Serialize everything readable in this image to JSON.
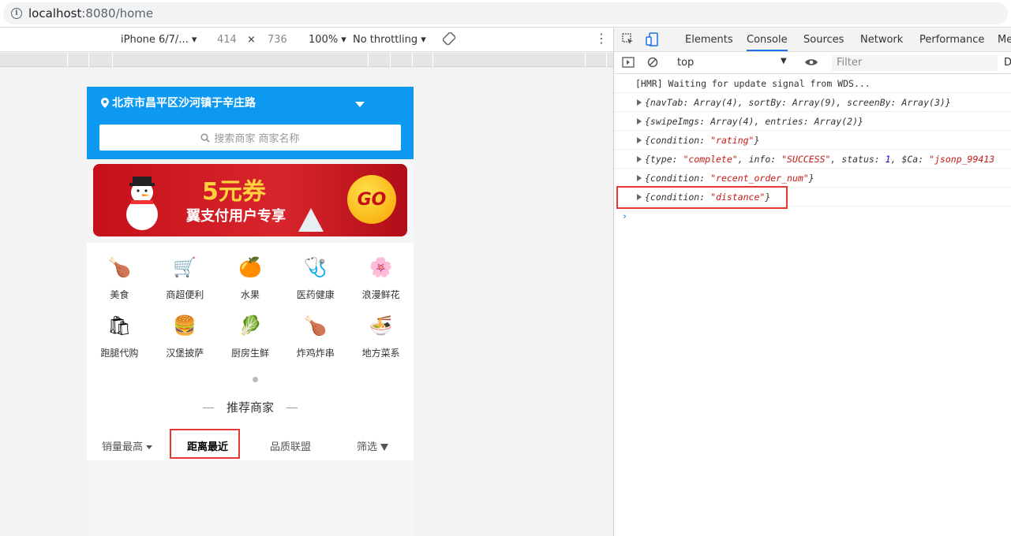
{
  "browser": {
    "url_host": "localhost",
    "url_path": ":8080/home"
  },
  "device_toolbar": {
    "device": "iPhone 6/7/...",
    "width": "414",
    "times": "×",
    "height": "736",
    "zoom": "100%",
    "throttling": "No throttling"
  },
  "app": {
    "location": "北京市昌平区沙河镇于辛庄路",
    "search_placeholder": "搜索商家 商家名称",
    "banner_title": "5元券",
    "banner_subtitle": "翼支付用户专享",
    "banner_go": "GO",
    "categories": [
      {
        "label": "美食",
        "icon": "food-icon",
        "glyph": "🍗"
      },
      {
        "label": "商超便利",
        "icon": "supermarket-icon",
        "glyph": "🛒"
      },
      {
        "label": "水果",
        "icon": "fruit-icon",
        "glyph": "🍊"
      },
      {
        "label": "医药健康",
        "icon": "medicine-icon",
        "glyph": "🩺"
      },
      {
        "label": "浪漫鲜花",
        "icon": "flower-icon",
        "glyph": "🌸"
      },
      {
        "label": "跑腿代购",
        "icon": "errand-icon",
        "glyph": "🛍"
      },
      {
        "label": "汉堡披萨",
        "icon": "burger-icon",
        "glyph": "🍔"
      },
      {
        "label": "厨房生鲜",
        "icon": "vegetable-icon",
        "glyph": "🥬"
      },
      {
        "label": "炸鸡炸串",
        "icon": "fried-chicken-icon",
        "glyph": "🍗"
      },
      {
        "label": "地方菜系",
        "icon": "noodle-bowl-icon",
        "glyph": "🍜"
      }
    ],
    "recommend_title": "推荐商家",
    "sort_tabs": {
      "sales": "销量最高",
      "distance": "距离最近",
      "quality": "品质联盟",
      "filter": "筛选"
    }
  },
  "devtools": {
    "tabs": [
      "Elements",
      "Console",
      "Sources",
      "Network",
      "Performance",
      "Me"
    ],
    "active_tab": "Console",
    "context": "top",
    "filter_placeholder": "Filter",
    "filter_trailing": "D",
    "console": {
      "hmr": "[HMR] Waiting for update signal from WDS...",
      "rows": [
        {
          "parts": [
            [
              "k",
              "{navTab: Array(4), sortBy: Array(9), screenBy: Array(3)}"
            ]
          ]
        },
        {
          "parts": [
            [
              "k",
              "{swipeImgs: Array(4), entries: Array(2)}"
            ]
          ]
        },
        {
          "parts": [
            [
              "k",
              "{condition: "
            ],
            [
              "s",
              "\"rating\""
            ],
            [
              "k",
              "}"
            ]
          ]
        },
        {
          "parts": [
            [
              "k",
              "{type: "
            ],
            [
              "s",
              "\"complete\""
            ],
            [
              "k",
              ", info: "
            ],
            [
              "s",
              "\"SUCCESS\""
            ],
            [
              "k",
              ", status: "
            ],
            [
              "n",
              "1"
            ],
            [
              "k",
              ", $Ca: "
            ],
            [
              "s",
              "\"jsonp_99413"
            ]
          ]
        },
        {
          "parts": [
            [
              "k",
              "{condition: "
            ],
            [
              "s",
              "\"recent_order_num\""
            ],
            [
              "k",
              "}"
            ]
          ]
        },
        {
          "parts": [
            [
              "k",
              "{condition: "
            ],
            [
              "s",
              "\"distance\""
            ],
            [
              "k",
              "}"
            ]
          ]
        }
      ],
      "prompt": "›"
    }
  },
  "colors": {
    "header_blue": "#0d99f0",
    "highlight_red": "#e53935",
    "string_red": "#c41a16",
    "number_blue": "#1c00cf"
  }
}
